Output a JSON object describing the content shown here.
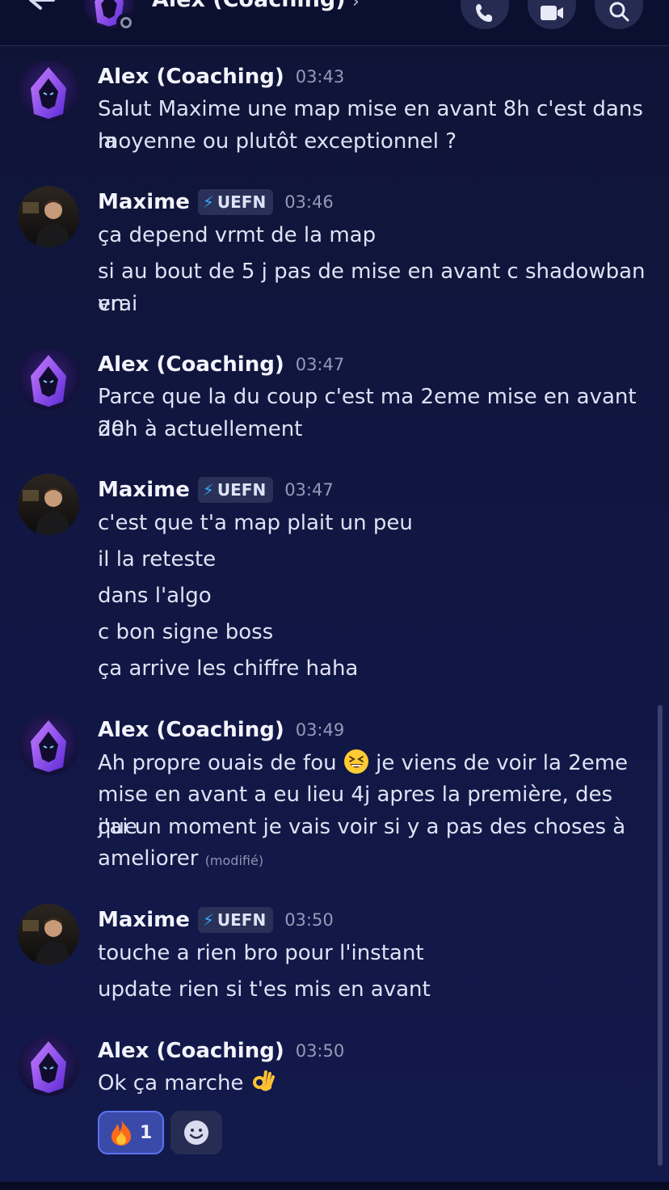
{
  "header": {
    "title": "Alex (Coaching)",
    "chevron": "›",
    "back_icon": "arrow-left-icon",
    "call_icon": "phone-icon",
    "video_icon": "video-camera-icon",
    "search_icon": "search-icon"
  },
  "messages": [
    {
      "author": "Alex (Coaching)",
      "time": "03:43",
      "lines": [
        "Salut Maxime une map mise en avant 8h c'est dans la",
        "moyenne ou plutôt exceptionnel ?"
      ]
    },
    {
      "author": "Maxime",
      "tag": "UEFN",
      "time": "03:46",
      "lines": [
        "ça depend vrmt de la map",
        "si au bout de 5 j pas de mise en avant c shadowban en",
        "vrai"
      ]
    },
    {
      "author": "Alex (Coaching)",
      "time": "03:47",
      "lines": [
        "Parce que la du coup c'est ma 2eme mise en avant de",
        "20h à actuellement"
      ]
    },
    {
      "author": "Maxime",
      "tag": "UEFN",
      "time": "03:47",
      "lines": [
        "c'est que t'a map plait un peu",
        "il la reteste",
        "dans l'algo",
        "c bon signe boss",
        "ça arrive les chiffre haha"
      ]
    },
    {
      "author": "Alex (Coaching)",
      "time": "03:49",
      "lines": [
        "Ah propre ouais de fou",
        "je viens de voir la 2eme",
        "mise en avant a eu lieu 4j apres la première, des que",
        "j'ai un moment je vais voir si y a pas des choses à",
        "ameliorer"
      ],
      "edited": "(modifié)"
    },
    {
      "author": "Maxime",
      "tag": "UEFN",
      "time": "03:50",
      "lines": [
        "touche a rien bro pour l'instant",
        "update rien si t'es mis en avant"
      ]
    },
    {
      "author": "Alex (Coaching)",
      "time": "03:50",
      "lines": [
        "Ok ça marche"
      ]
    }
  ],
  "reactions": {
    "fire": {
      "icon": "fire-emoji",
      "count": "1"
    },
    "add_icon": "add-reaction-icon"
  },
  "colors": {
    "background": "#111642",
    "header": "#0c1030",
    "tag_bolt": "#35a7ff",
    "reaction_active": "#3a4aa8"
  }
}
